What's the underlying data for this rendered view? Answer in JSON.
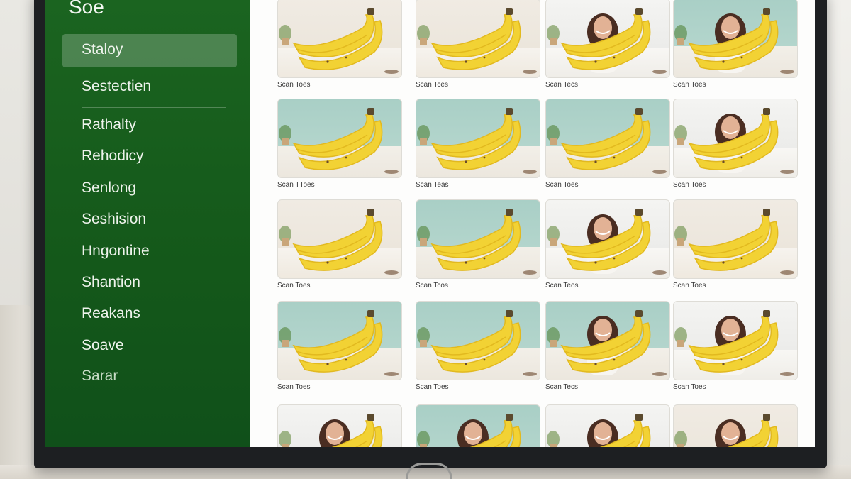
{
  "app": {
    "title": "Soe"
  },
  "sidebar": {
    "items": [
      {
        "label": "Staloy",
        "active": true
      },
      {
        "label": "Sestectien"
      },
      {
        "label": "Rathalty"
      },
      {
        "label": "Rehodicy"
      },
      {
        "label": "Senlong"
      },
      {
        "label": "Seshision"
      },
      {
        "label": "Hngontine"
      },
      {
        "label": "Shantion"
      },
      {
        "label": "Reakans"
      },
      {
        "label": "Soave"
      },
      {
        "label": "Sarar"
      }
    ]
  },
  "gallery": {
    "rows": [
      {
        "cards": [
          {
            "caption": "Scan Toes",
            "style": "warm",
            "person": false
          },
          {
            "caption": "Scan Tces",
            "style": "warm",
            "person": false
          },
          {
            "caption": "Scan Tecs",
            "style": "light",
            "person": true
          },
          {
            "caption": "Scan Toes",
            "style": "teal",
            "person": true
          }
        ]
      },
      {
        "cards": [
          {
            "caption": "Scan TToes",
            "style": "teal",
            "person": false
          },
          {
            "caption": "Scan Teas",
            "style": "teal",
            "person": false
          },
          {
            "caption": "Scan Toes",
            "style": "teal",
            "person": false
          },
          {
            "caption": "Scan Toes",
            "style": "light",
            "person": true
          }
        ]
      },
      {
        "cards": [
          {
            "caption": "Scan Toes",
            "style": "warm",
            "person": false
          },
          {
            "caption": "Scan Tcos",
            "style": "teal",
            "person": false
          },
          {
            "caption": "Scan Teos",
            "style": "light",
            "person": true
          },
          {
            "caption": "Scan Toes",
            "style": "warm",
            "person": false
          }
        ]
      },
      {
        "cards": [
          {
            "caption": "Scan Toes",
            "style": "teal",
            "person": false
          },
          {
            "caption": "Scan Toes",
            "style": "teal",
            "person": false
          },
          {
            "caption": "Scan Tecs",
            "style": "teal",
            "person": true
          },
          {
            "caption": "Scan Toes",
            "style": "light",
            "person": true
          }
        ]
      },
      {
        "cards": [
          {
            "caption": "",
            "style": "light",
            "person": true
          },
          {
            "caption": "",
            "style": "teal",
            "person": true
          },
          {
            "caption": "",
            "style": "light",
            "person": true
          },
          {
            "caption": "",
            "style": "warm",
            "person": true
          }
        ]
      }
    ]
  },
  "colors": {
    "sidebar": "#14581a",
    "banana": "#f2d234",
    "banana_shade": "#e2b91f"
  },
  "icons": {
    "thumbnail": "banana-photo-icon",
    "person": "person-photo-icon"
  }
}
